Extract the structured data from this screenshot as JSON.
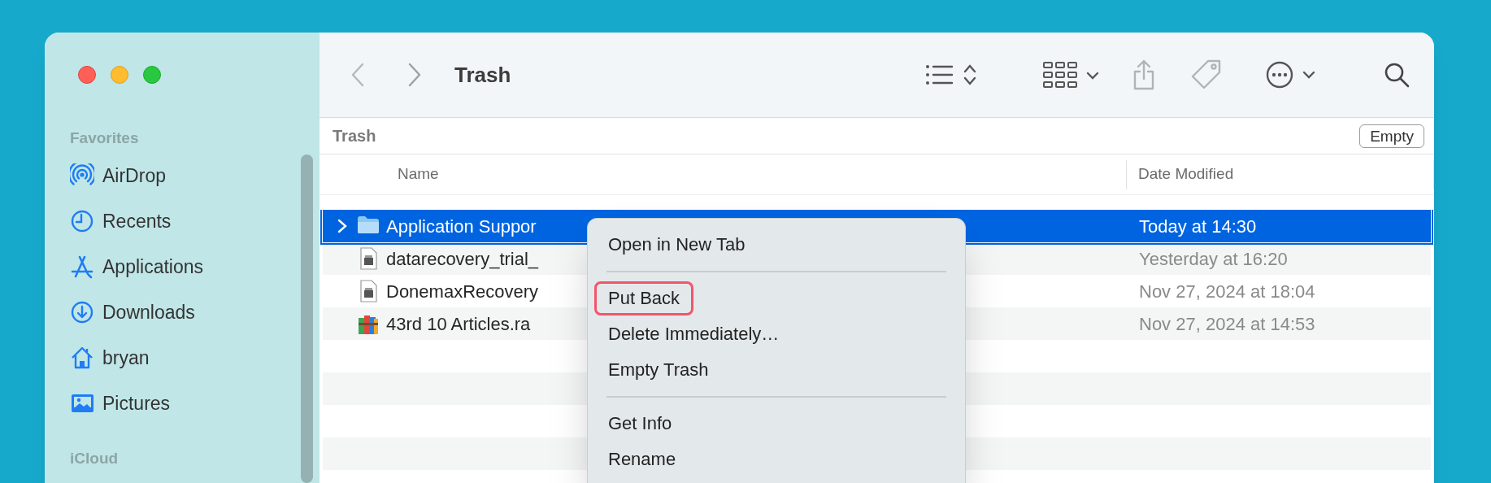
{
  "toolbar": {
    "title": "Trash"
  },
  "sidebar": {
    "sections": [
      {
        "heading": "Favorites",
        "items": [
          {
            "label": "AirDrop",
            "kind": "airdrop"
          },
          {
            "label": "Recents",
            "kind": "recents"
          },
          {
            "label": "Applications",
            "kind": "applications"
          },
          {
            "label": "Downloads",
            "kind": "downloads"
          },
          {
            "label": "bryan",
            "kind": "home"
          },
          {
            "label": "Pictures",
            "kind": "pictures"
          }
        ]
      },
      {
        "heading": "iCloud"
      }
    ]
  },
  "path_bar": {
    "title": "Trash",
    "button": "Empty"
  },
  "table": {
    "columns": [
      "Name",
      "Date Modified"
    ],
    "rows": [
      {
        "name": "Application Suppor",
        "date": "Today at 14:30",
        "kind": "folder",
        "selected": true
      },
      {
        "name": "datarecovery_trial_",
        "date": "Yesterday at 16:20",
        "kind": "document",
        "selected": false
      },
      {
        "name": "DonemaxRecovery",
        "date": "Nov 27, 2024 at 18:04",
        "kind": "document",
        "selected": false
      },
      {
        "name": "43rd 10 Articles.ra",
        "date": "Nov 27, 2024 at 14:53",
        "kind": "archive",
        "selected": false
      }
    ]
  },
  "context_menu": {
    "items": [
      {
        "kind": "item",
        "label": "Open in New Tab",
        "highlighted": false
      },
      {
        "kind": "separator"
      },
      {
        "kind": "item",
        "label": "Put Back",
        "highlighted": true
      },
      {
        "kind": "item",
        "label": "Delete Immediately…",
        "highlighted": false
      },
      {
        "kind": "item",
        "label": "Empty Trash",
        "highlighted": false
      },
      {
        "kind": "separator"
      },
      {
        "kind": "item",
        "label": "Get Info",
        "highlighted": false
      },
      {
        "kind": "item",
        "label": "Rename",
        "highlighted": false
      }
    ]
  }
}
